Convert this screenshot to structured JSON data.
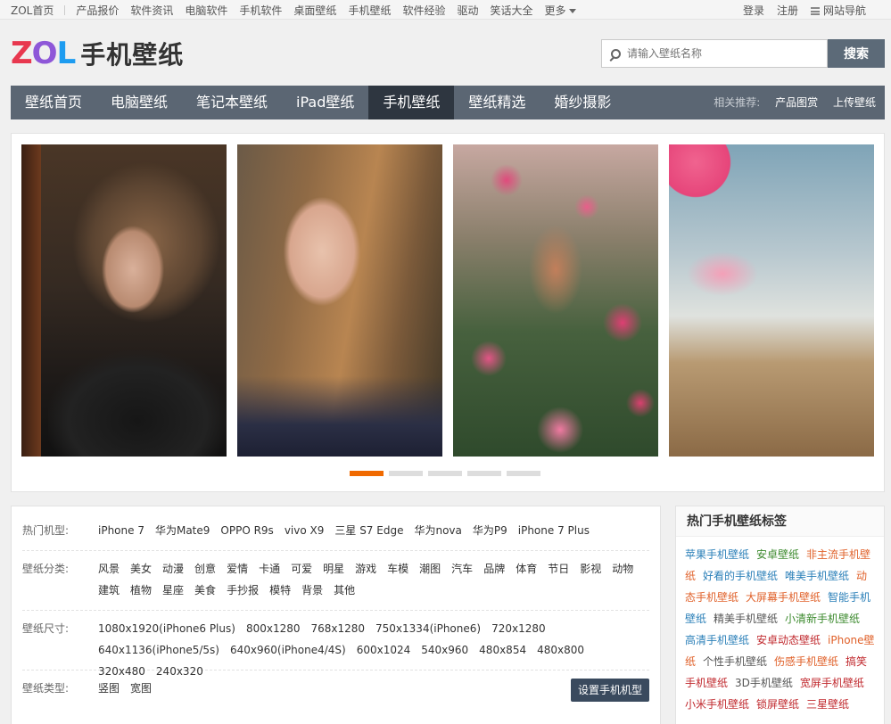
{
  "topbar": {
    "left_links": [
      "ZOL首页",
      "产品报价",
      "软件资讯",
      "电脑软件",
      "手机软件",
      "桌面壁纸",
      "手机壁纸",
      "软件经验",
      "驱动",
      "笑话大全"
    ],
    "more": "更多",
    "login": "登录",
    "register": "注册",
    "site_nav": "网站导航"
  },
  "header": {
    "logo_brand": "ZOL",
    "logo_title": "手机壁纸",
    "search_placeholder": "请输入壁纸名称",
    "search_button": "搜索"
  },
  "nav": {
    "items": [
      "壁纸首页",
      "电脑壁纸",
      "笔记本壁纸",
      "iPad壁纸",
      "手机壁纸",
      "壁纸精选",
      "婚纱摄影"
    ],
    "active_index": 4,
    "related_label": "相关推荐:",
    "related_links": [
      "产品图赏",
      "上传壁纸"
    ]
  },
  "slider": {
    "active_dot": 0,
    "dot_count": 5
  },
  "filters": {
    "hot_models": {
      "label": "热门机型:",
      "values": [
        "iPhone 7",
        "华为Mate9",
        "OPPO R9s",
        "vivo X9",
        "三星 S7 Edge",
        "华为nova",
        "华为P9",
        "iPhone 7 Plus"
      ]
    },
    "categories": {
      "label": "壁纸分类:",
      "values": [
        "风景",
        "美女",
        "动漫",
        "创意",
        "爱情",
        "卡通",
        "可爱",
        "明星",
        "游戏",
        "车模",
        "潮图",
        "汽车",
        "品牌",
        "体育",
        "节日",
        "影视",
        "动物",
        "建筑",
        "植物",
        "星座",
        "美食",
        "手抄报",
        "模特",
        "背景",
        "其他"
      ]
    },
    "sizes": {
      "label": "壁纸尺寸:",
      "values": [
        "1080x1920(iPhone6 Plus)",
        "800x1280",
        "768x1280",
        "750x1334(iPhone6)",
        "720x1280",
        "640x1136(iPhone5/5s)",
        "640x960(iPhone4/4S)",
        "600x1024",
        "540x960",
        "480x854",
        "480x800",
        "320x480",
        "240x320"
      ]
    },
    "types": {
      "label": "壁纸类型:",
      "values": [
        "竖图",
        "宽图"
      ]
    },
    "set_model_button": "设置手机机型"
  },
  "hot_tags": {
    "title": "热门手机壁纸标签",
    "tags": [
      {
        "text": "苹果手机壁纸",
        "color": "#2a7fb8"
      },
      {
        "text": "安卓壁纸",
        "color": "#3c8a2e"
      },
      {
        "text": "非主流手机壁纸",
        "color": "#e0612a"
      },
      {
        "text": "好看的手机壁纸",
        "color": "#2a7fb8"
      },
      {
        "text": "唯美手机壁纸",
        "color": "#2a7fb8"
      },
      {
        "text": "动态手机壁纸",
        "color": "#e0612a"
      },
      {
        "text": "大屏幕手机壁纸",
        "color": "#e0612a"
      },
      {
        "text": "智能手机壁纸",
        "color": "#2a7fb8"
      },
      {
        "text": "精美手机壁纸",
        "color": "#555555"
      },
      {
        "text": "小清新手机壁纸",
        "color": "#3c8a2e"
      },
      {
        "text": "高清手机壁纸",
        "color": "#2a7fb8"
      },
      {
        "text": "安卓动态壁纸",
        "color": "#c0282d"
      },
      {
        "text": "iPhone壁纸",
        "color": "#e0612a"
      },
      {
        "text": "个性手机壁纸",
        "color": "#555555"
      },
      {
        "text": "伤感手机壁纸",
        "color": "#e0612a"
      },
      {
        "text": "搞笑手机壁纸",
        "color": "#c0282d"
      },
      {
        "text": "3D手机壁纸",
        "color": "#555555"
      },
      {
        "text": "宽屏手机壁纸",
        "color": "#c0282d"
      },
      {
        "text": "小米手机壁纸",
        "color": "#c0282d"
      },
      {
        "text": "锁屏壁纸",
        "color": "#c0282d"
      },
      {
        "text": "三星壁纸",
        "color": "#c0282d"
      }
    ]
  }
}
